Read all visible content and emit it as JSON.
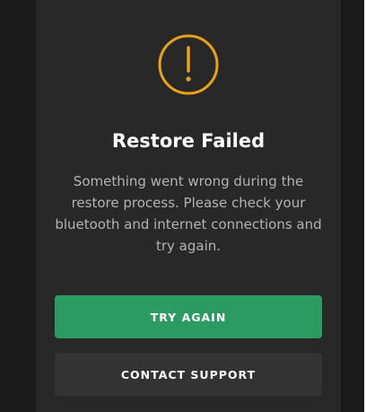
{
  "dialog": {
    "icon": "exclamation-circle-icon",
    "title": "Restore Failed",
    "message": "Something went wrong during the restore process. Please check your bluetooth and internet connections and try again.",
    "primary_button": "TRY AGAIN",
    "secondary_button": "CONTACT SUPPORT"
  },
  "colors": {
    "accent_icon": "#e8a317",
    "primary_button_bg": "#2b9b61",
    "secondary_button_bg": "#333333",
    "dialog_bg": "#282828",
    "backdrop_bg": "#1b1b1b"
  }
}
